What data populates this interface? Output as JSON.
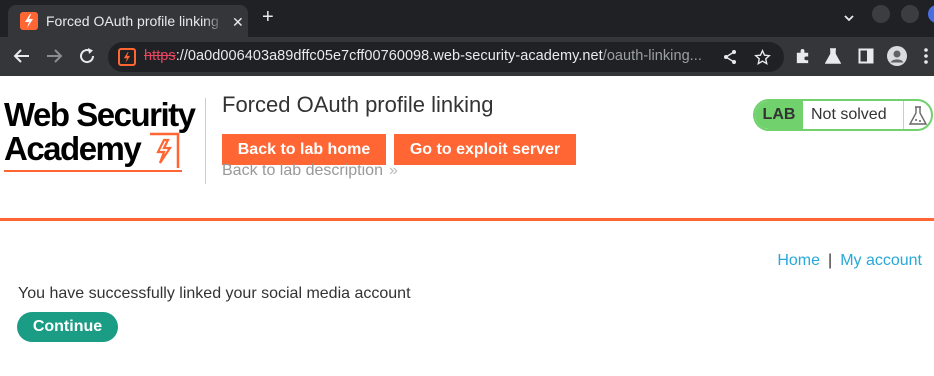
{
  "browser": {
    "tab_title": "Forced OAuth profile linking",
    "new_tab_symbol": "+",
    "close_symbol": "✕",
    "url_scheme": "https",
    "url_host": "://0a0d006403a89dffc05e7cff00760098.web-security-academy.net",
    "url_path": "/oauth-linking...",
    "icons": [
      "back-icon",
      "forward-icon",
      "reload-icon",
      "share-icon",
      "star-icon",
      "extensions-icon",
      "labs-icon",
      "sidepanel-icon",
      "profile-icon",
      "menu-icon"
    ]
  },
  "header": {
    "logo_line1": "Web Security",
    "logo_line2": "Academy",
    "lab_title": "Forced OAuth profile linking",
    "back_to_lab_home": "Back to lab home",
    "go_to_exploit_server": "Go to exploit server",
    "back_to_lab_description": "Back to lab description",
    "desc_chevron": "»"
  },
  "lab_status": {
    "tag": "LAB",
    "status": "Not solved"
  },
  "nav": {
    "home": "Home",
    "separator": "|",
    "my_account": "My account"
  },
  "main": {
    "message": "You have successfully linked your social media account",
    "continue_label": "Continue"
  },
  "colors": {
    "accent": "#ff6633",
    "link": "#29a8d9",
    "success": "#70d16d",
    "continue": "#1b9c85"
  }
}
